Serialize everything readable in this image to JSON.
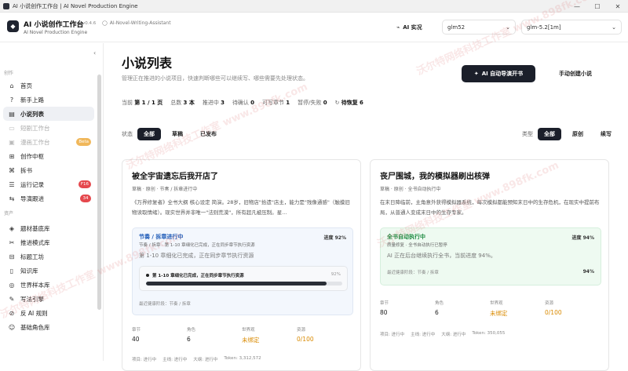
{
  "window": {
    "title": "AI 小说创作工作台 | AI Novel Production Engine",
    "controls": [
      "—",
      "☐",
      "✕"
    ]
  },
  "header": {
    "brand": "AI 小说创作工作台",
    "brand_sub": "AI Novel Production Engine",
    "version": "v0.4.6",
    "repo": "AI-Novel-Writing-Assistant",
    "ai_live": "AI 实况",
    "provider": "glm52",
    "model": "glm-5.2[1m]"
  },
  "sidebar": {
    "section_create": "创作",
    "section_assets": "资产",
    "items": [
      {
        "label": "首页",
        "icon": "⌂"
      },
      {
        "label": "新手上路",
        "icon": "?"
      },
      {
        "label": "小说列表",
        "icon": "▤"
      },
      {
        "label": "短剧工作台",
        "icon": "▭"
      },
      {
        "label": "漫画工作台",
        "icon": "▣",
        "badge": "Beta"
      },
      {
        "label": "创作中枢",
        "icon": "⊞"
      },
      {
        "label": "拆书",
        "icon": "⌘"
      },
      {
        "label": "运行记录",
        "icon": "☰",
        "badge": "F16"
      },
      {
        "label": "导演跟进",
        "icon": "⇆",
        "badge": "34"
      },
      {
        "label": "题材基底库",
        "icon": "◈"
      },
      {
        "label": "推进模式库",
        "icon": "✂"
      },
      {
        "label": "标题工坊",
        "icon": "⊟"
      },
      {
        "label": "知识库",
        "icon": "▯"
      },
      {
        "label": "世界样本库",
        "icon": "◎"
      },
      {
        "label": "写法引擎",
        "icon": "✎"
      },
      {
        "label": "反 AI 规则",
        "icon": "⊘"
      },
      {
        "label": "基础角色库",
        "icon": "☺"
      }
    ]
  },
  "main": {
    "title": "小说列表",
    "description": "管理正在推进的小说项目，快速判断哪些可以继续写、哪些需要先处理状态。",
    "auto_button": "AI 自动导演开书",
    "create_button": "手动创建小说",
    "stats": {
      "page_label": "当前",
      "page_value": "第 1 / 1 页",
      "total_label": "总数",
      "total_value": "3 本",
      "active_label": "推进中",
      "active_value": "3",
      "pending_label": "待确认",
      "pending_value": "0",
      "writable_label": "可写章节",
      "writable_value": "1",
      "paused_label": "暂停/失败",
      "paused_value": "0",
      "recover_label": "待恢复",
      "recover_value": "6"
    },
    "filters": {
      "status_label": "状态",
      "status": [
        "全部",
        "草稿",
        "已发布"
      ],
      "type_label": "类型",
      "types": [
        "全部",
        "原创",
        "续写"
      ]
    }
  },
  "cards": [
    {
      "title": "被全宇宙遗忘后我开店了",
      "meta": "草稿 · 原创 · 节奏 / 拆章进行中",
      "synopsis": "《万界修复者》全书大纲 核心设定 简演。28岁，旧物店\"拾遗\"店主，能力是\"残像通感\"（触摸旧物读取情绪）。现实世界并非唯一\"法则荒漠\"，所有超凡被压制。星...",
      "phase": "节奏 / 拆章进行中",
      "progress": "进度 92%",
      "phase_sub": "节奏 / 拆章 · 第 1-10 章细化已完成，正在同步章节执行资源",
      "message": "第 1-10 章细化已完成，正在同步章节执行资源",
      "inner_text": "第 1-10 章细化已完成，正在同步章节执行资源",
      "inner_pct": "92%",
      "fill": 0.92,
      "last": "最近健康阶段：节奏 / 拆章",
      "metrics": [
        {
          "label": "章节",
          "value": "40"
        },
        {
          "label": "角色",
          "value": "6"
        },
        {
          "label": "世界观",
          "value": "未绑定"
        },
        {
          "label": "资源",
          "value": "0/100"
        }
      ],
      "footer": [
        "项目: 进行中",
        "主线: 进行中",
        "大纲: 进行中",
        "Token: 3,312,572"
      ]
    },
    {
      "title": "丧尸围城，我的模拟器刷出核弹",
      "meta": "草稿 · 原创 · 全书自动执行中",
      "synopsis": "在末日降临前，主角意外获得模拟器系统，每次模拟都能预知末日中的生存危机，在现实中提前布局，从普通人变成末日中的生存专家。",
      "phase": "全书自动执行中",
      "progress": "进度 94%",
      "phase_sub": "质量修复 · 全书自动执行已暂停",
      "message": "AI 正在后台继续执行全书，当前进度 94%。",
      "last": "最近健康阶段：节奏 / 拆章",
      "last_pct": "94%",
      "metrics": [
        {
          "label": "章节",
          "value": "80"
        },
        {
          "label": "角色",
          "value": "6"
        },
        {
          "label": "世界观",
          "value": "未绑定"
        },
        {
          "label": "资源",
          "value": "0/100"
        }
      ],
      "footer": [
        "项目: 进行中",
        "主线: 进行中",
        "大纲: 进行中",
        "Token: 350,055"
      ]
    }
  ],
  "watermark": "沃尔特网络科技工作室 www.898fk.com",
  "colors": {
    "dark": "#1b1f2a",
    "blue": "#1e5bb8",
    "green": "#1d8a40",
    "badge_red": "#e5484d",
    "beta": "#f0b75a",
    "warning": "#d98a00"
  }
}
